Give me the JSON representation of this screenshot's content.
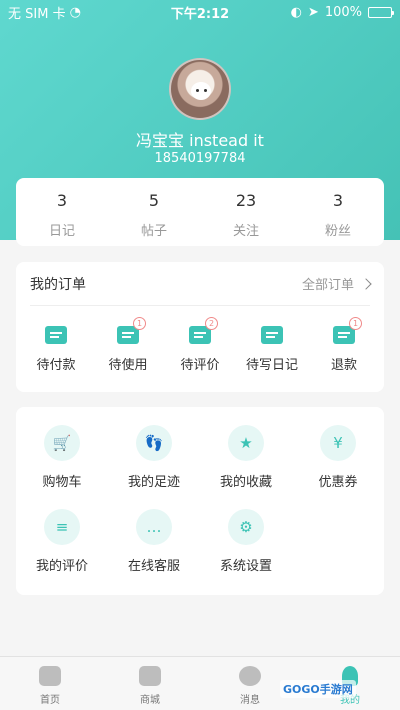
{
  "status_bar": {
    "carrier": "无 SIM 卡",
    "time": "下午2:12",
    "battery": "100%"
  },
  "profile": {
    "username": "冯宝宝 instead it",
    "phone": "18540197784"
  },
  "stats": [
    {
      "value": "3",
      "label": "日记"
    },
    {
      "value": "5",
      "label": "帖子"
    },
    {
      "value": "23",
      "label": "关注"
    },
    {
      "value": "3",
      "label": "粉丝"
    }
  ],
  "orders": {
    "title": "我的订单",
    "all_label": "全部订单",
    "items": [
      {
        "label": "待付款",
        "icon": "wallet-icon"
      },
      {
        "label": "待使用",
        "icon": "ticket-icon",
        "badge": "1"
      },
      {
        "label": "待评价",
        "icon": "comment-icon",
        "badge": "2"
      },
      {
        "label": "待写日记",
        "icon": "diary-icon"
      },
      {
        "label": "退款",
        "icon": "refund-icon",
        "badge": "1"
      }
    ]
  },
  "tools": [
    {
      "label": "购物车",
      "icon": "cart-icon",
      "glyph": "🛒"
    },
    {
      "label": "我的足迹",
      "icon": "footprint-icon",
      "glyph": "👣"
    },
    {
      "label": "我的收藏",
      "icon": "star-icon",
      "glyph": "★"
    },
    {
      "label": "优惠券",
      "icon": "coupon-icon",
      "glyph": "¥"
    },
    {
      "label": "我的评价",
      "icon": "review-icon",
      "glyph": "≡"
    },
    {
      "label": "在线客服",
      "icon": "chat-icon",
      "glyph": "…"
    },
    {
      "label": "系统设置",
      "icon": "gear-icon",
      "glyph": "⚙"
    }
  ],
  "tabbar": [
    {
      "label": "首页",
      "icon": "home-icon"
    },
    {
      "label": "商城",
      "icon": "shop-icon"
    },
    {
      "label": "消息",
      "icon": "message-icon"
    },
    {
      "label": "我的",
      "icon": "user-icon",
      "active": true
    }
  ],
  "watermark": "GOGO手游网",
  "colors": {
    "accent": "#3cc3b5",
    "header_start": "#5fd8cf",
    "header_end": "#45c2b6",
    "badge": "#f08a8a"
  }
}
